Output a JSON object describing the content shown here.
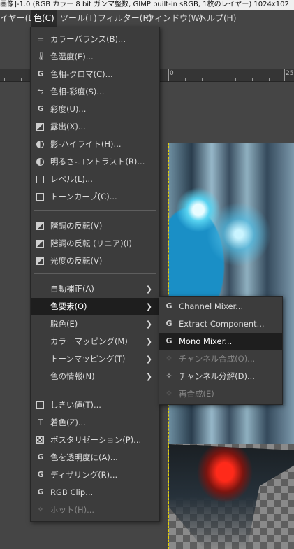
{
  "window": {
    "title": "画像]-1.0 (RGB カラー 8 bit ガンマ整数, GIMP built-in sRGB, 1枚のレイヤー) 1024x102"
  },
  "menubar": {
    "items": [
      "イヤー(L)",
      "色(C)",
      "ツール(T)",
      "フィルター(R)",
      "ウィンドウ(W)",
      "ヘルプ(H)"
    ]
  },
  "ruler": {
    "labels": [
      "0",
      "25"
    ]
  },
  "color_menu": {
    "group1": [
      {
        "label": "カラーバランス(B)...",
        "icon": "color-balance-icon"
      },
      {
        "label": "色温度(E)...",
        "icon": "thermometer-icon"
      },
      {
        "label": "色相-クロマ(C)...",
        "icon": "gegl-icon"
      },
      {
        "label": "色相-彩度(S)...",
        "icon": "hue-saturation-icon"
      },
      {
        "label": "彩度(U)...",
        "icon": "gegl-icon"
      },
      {
        "label": "露出(X)...",
        "icon": "exposure-icon"
      },
      {
        "label": "影-ハイライト(H)...",
        "icon": "shadows-highlights-icon"
      },
      {
        "label": "明るさ-コントラスト(R)...",
        "icon": "brightness-contrast-icon"
      },
      {
        "label": "レベル(L)...",
        "icon": "levels-icon"
      },
      {
        "label": "トーンカーブ(C)...",
        "icon": "curves-icon"
      }
    ],
    "group2": [
      {
        "label": "階調の反転(V)",
        "icon": "invert-icon"
      },
      {
        "label": "階調の反転 (リニア)(I)",
        "icon": "invert-linear-icon"
      },
      {
        "label": "光度の反転(V)",
        "icon": "value-invert-icon"
      }
    ],
    "group3": [
      {
        "label": "自動補正(A)"
      },
      {
        "label": "色要素(O)"
      },
      {
        "label": "脱色(E)"
      },
      {
        "label": "カラーマッピング(M)"
      },
      {
        "label": "トーンマッピング(T)"
      },
      {
        "label": "色の情報(N)"
      }
    ],
    "group4": [
      {
        "label": "しきい値(T)...",
        "icon": "threshold-icon"
      },
      {
        "label": "着色(Z)...",
        "icon": "colorize-icon"
      },
      {
        "label": "ポスタリゼーション(P)...",
        "icon": "posterize-icon"
      },
      {
        "label": "色を透明度に(A)...",
        "icon": "gegl-icon"
      },
      {
        "label": "ディザリング(R)...",
        "icon": "gegl-icon"
      },
      {
        "label": "RGB Clip...",
        "icon": "gegl-icon"
      },
      {
        "label": "ホット(H)...",
        "icon": "plugin-icon",
        "disabled": true
      }
    ]
  },
  "components_submenu": {
    "items": [
      {
        "label": "Channel Mixer...",
        "icon": "gegl-icon"
      },
      {
        "label": "Extract Component...",
        "icon": "gegl-icon"
      },
      {
        "label": "Mono Mixer...",
        "icon": "gegl-icon",
        "highlighted": true
      },
      {
        "label": "チャンネル合成(O)...",
        "icon": "plugin-icon",
        "disabled": true
      },
      {
        "label": "チャンネル分解(D)...",
        "icon": "plugin-icon"
      },
      {
        "label": "再合成(E)",
        "icon": "plugin-icon",
        "disabled": true
      }
    ]
  },
  "colors": {
    "menu_bg": "#3c3c3c",
    "highlight_bg": "#1e1e1e",
    "selection_border": "#e6d400"
  }
}
